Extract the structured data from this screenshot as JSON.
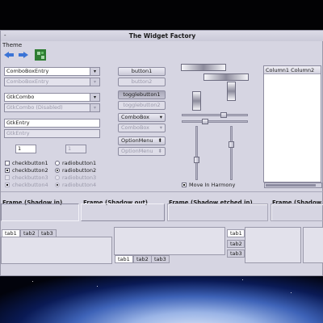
{
  "window": {
    "title": "The Widget Factory",
    "menu_dash": "-"
  },
  "menubar": {
    "theme": "Theme"
  },
  "toolbar": {
    "back_icon": "back-arrow-icon",
    "forward_icon": "forward-arrow-icon",
    "app_icon": "puzzle-icon"
  },
  "left_column": {
    "combo_entry": "ComboBoxEntry",
    "combo_entry_disabled": "ComboBoxEntry",
    "gtk_combo": "GtkCombo",
    "gtk_combo_disabled": "GtkCombo (Disabled)",
    "entry": "GtkEntry",
    "entry_disabled": "GtkEntry",
    "spin_value": "1",
    "spin_value_disabled": "1",
    "check1": "checkbutton1",
    "check2": "checkbutton2",
    "check3": "checkbutton3",
    "check4": "checkbutton4",
    "radio1": "radiobutton1",
    "radio2": "radiobutton2",
    "radio3": "radiobutton3",
    "radio4": "radiobutton4"
  },
  "middle_column": {
    "button1": "button1",
    "button2": "button2",
    "toggle1": "togglebutton1",
    "toggle2": "togglebutton2",
    "combo_box": "ComboBox",
    "combo_box_disabled": "ComboBox",
    "option_menu": "OptionMenu",
    "option_menu_disabled": "OptionMenu"
  },
  "right_column": {
    "move_in_harmony": "Move In Harmony",
    "tree_header": "Column1 Column2"
  },
  "frames": {
    "shadow_in": "Frame (Shadow in)",
    "shadow_out": "Frame (Shadow out)",
    "shadow_etched_in": "Frame (Shadow etched in)",
    "shadow_last": "Frame (Shadow"
  },
  "tabs": {
    "top": [
      "tab1",
      "tab2",
      "tab3"
    ],
    "bottom": [
      "tab1",
      "tab2",
      "tab3"
    ],
    "left": [
      "tab1",
      "tab2",
      "tab3"
    ]
  }
}
